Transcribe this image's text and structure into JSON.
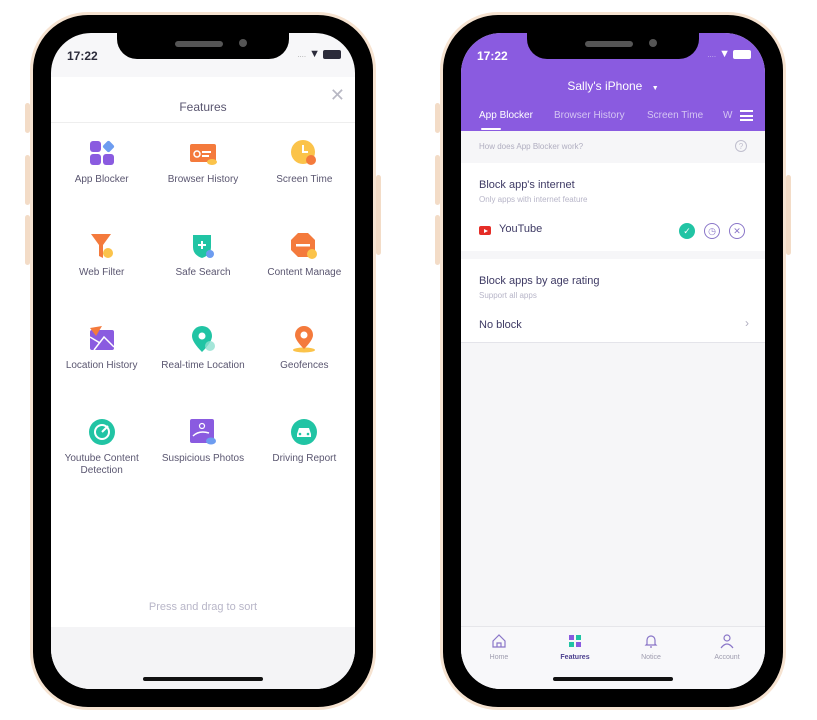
{
  "status_bar": {
    "time": "17:22",
    "signal": "....",
    "location_arrow": "➤"
  },
  "features_screen": {
    "title": "Features",
    "close_icon": "✕",
    "items": [
      {
        "label": "App Blocker",
        "icon": "app-blocker-icon"
      },
      {
        "label": "Browser History",
        "icon": "browser-history-icon"
      },
      {
        "label": "Screen Time",
        "icon": "screen-time-icon"
      },
      {
        "label": "Web Filter",
        "icon": "web-filter-icon"
      },
      {
        "label": "Safe Search",
        "icon": "safe-search-icon"
      },
      {
        "label": "Content Manage",
        "icon": "content-manage-icon"
      },
      {
        "label": "Location History",
        "icon": "location-history-icon"
      },
      {
        "label": "Real-time Location",
        "icon": "realtime-location-icon"
      },
      {
        "label": "Geofences",
        "icon": "geofences-icon"
      },
      {
        "label": "Youtube Content Detection",
        "icon": "youtube-detection-icon"
      },
      {
        "label": "Suspicious Photos",
        "icon": "suspicious-photos-icon"
      },
      {
        "label": "Driving Report",
        "icon": "driving-report-icon"
      }
    ],
    "hint": "Press and drag to sort"
  },
  "app_blocker_screen": {
    "device_name": "Sally's iPhone",
    "device_dropdown": "▼",
    "tabs": [
      "App Blocker",
      "Browser History",
      "Screen Time",
      "W"
    ],
    "active_tab": "App Blocker",
    "help_text": "How does App Blocker work?",
    "help_icon": "?",
    "block_internet": {
      "title": "Block app's internet",
      "subtitle": "Only apps with internet feature",
      "apps": [
        {
          "name": "YouTube",
          "status": "allowed"
        }
      ],
      "check": "✓",
      "clock": "◷",
      "cancel": "✕"
    },
    "block_age": {
      "title": "Block apps by age rating",
      "subtitle": "Support all apps",
      "value": "No block",
      "chevron": "›"
    },
    "tabbar": [
      {
        "label": "Home",
        "active": false
      },
      {
        "label": "Features",
        "active": true
      },
      {
        "label": "Notice",
        "active": false
      },
      {
        "label": "Account",
        "active": false
      }
    ]
  },
  "colors": {
    "accent": "#8a5be0",
    "teal": "#21c4a4",
    "orange": "#f47a3c",
    "youtube": "#e52d27"
  }
}
